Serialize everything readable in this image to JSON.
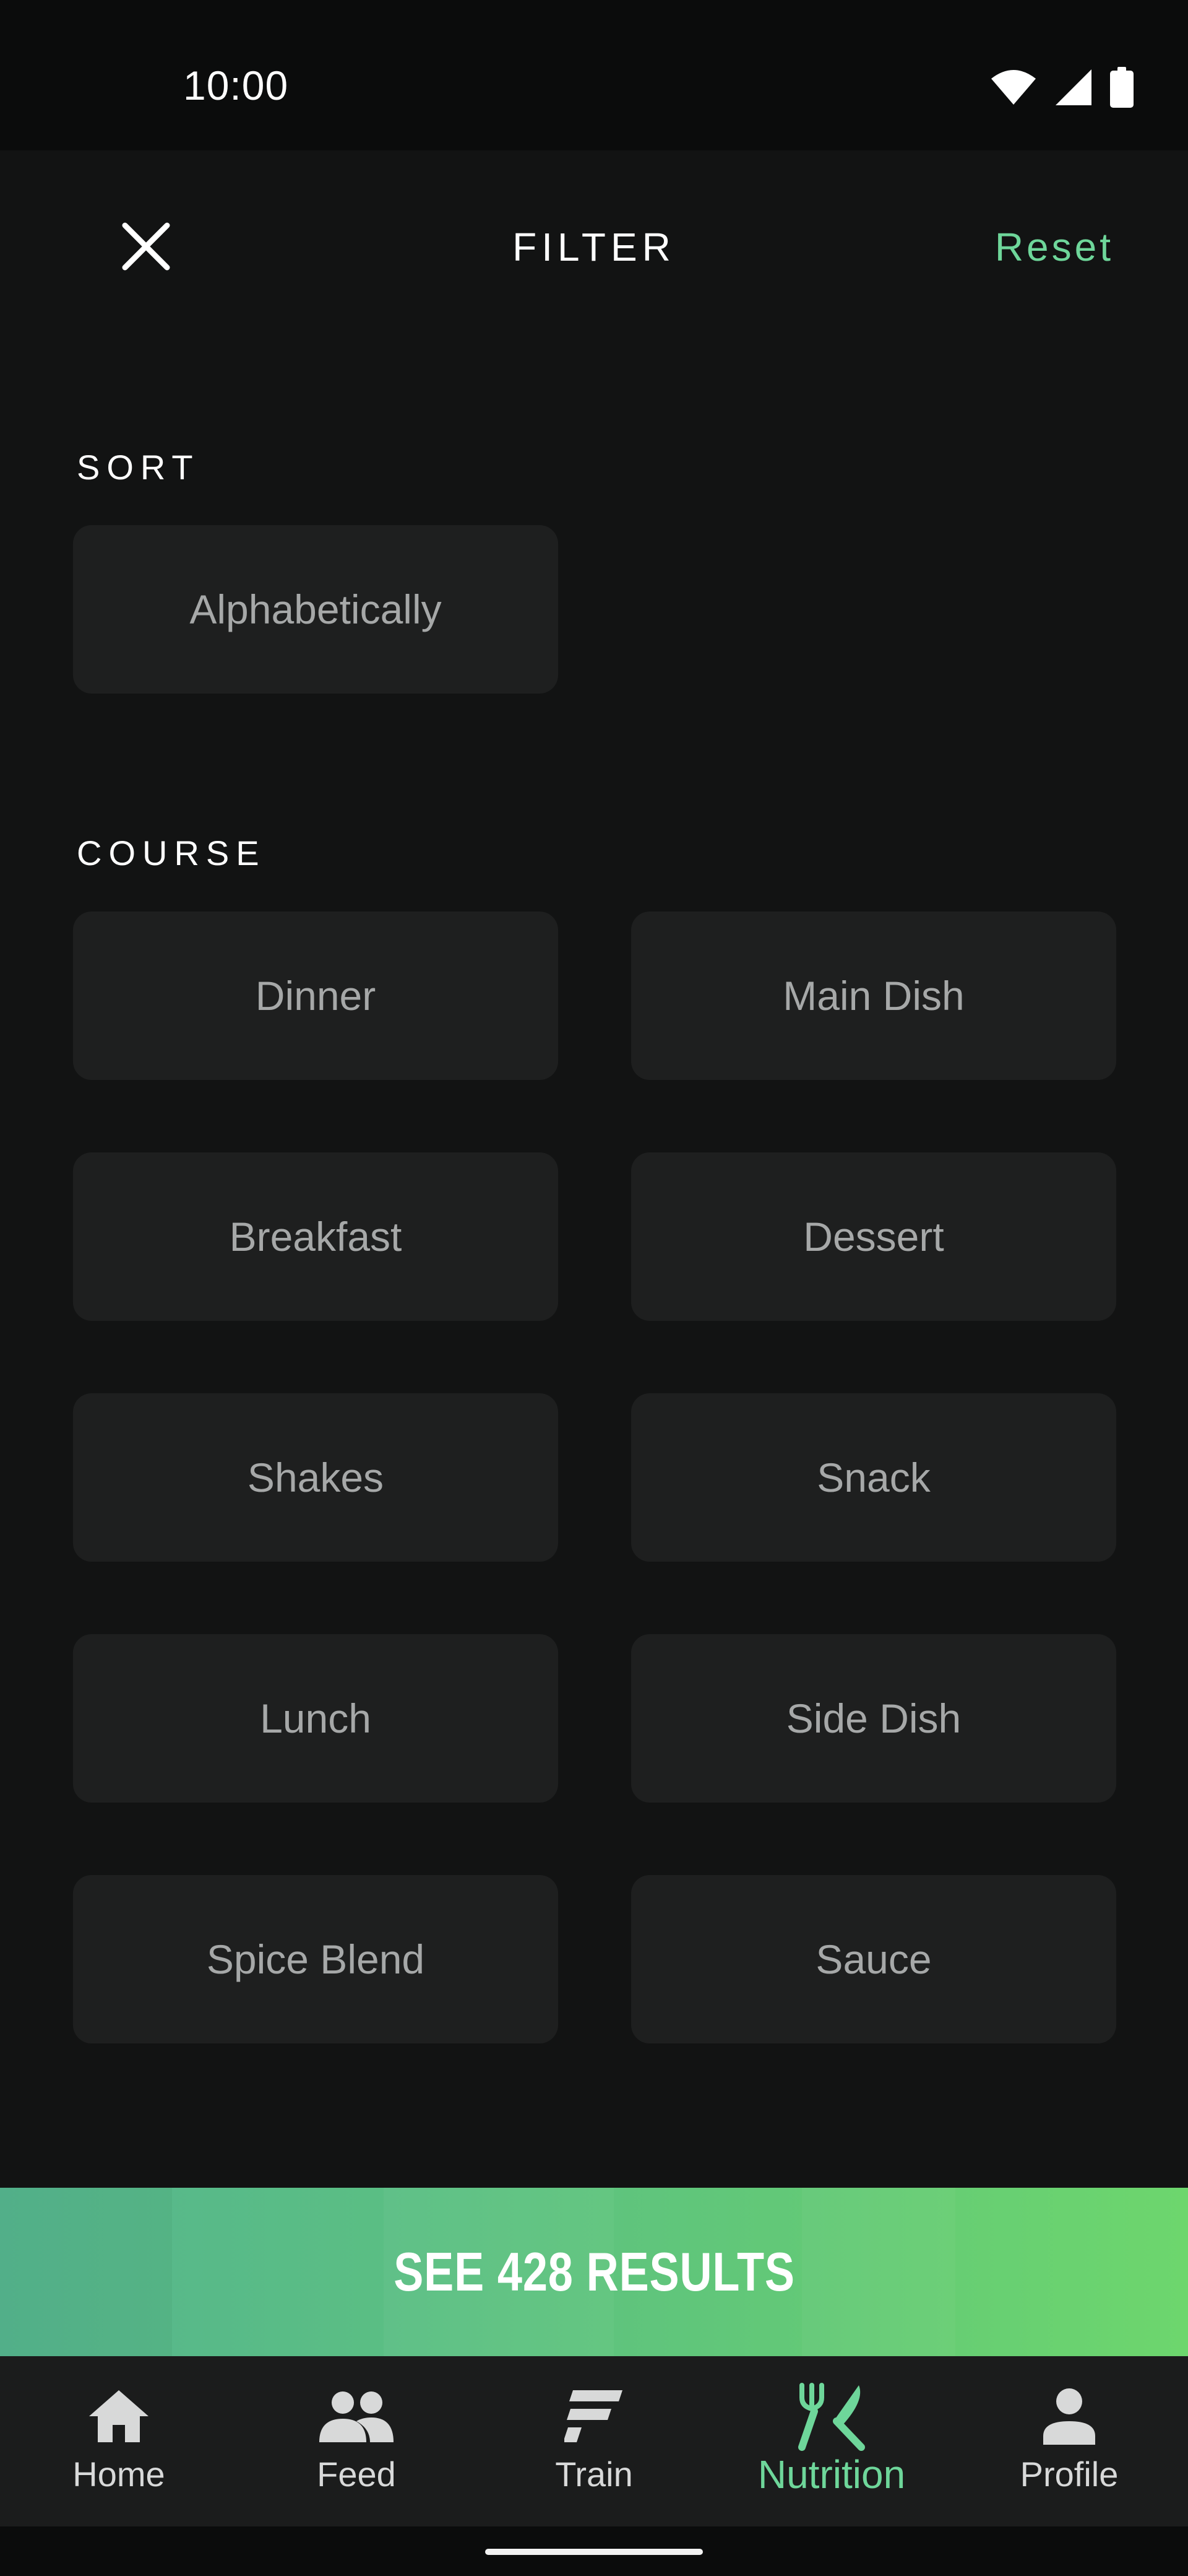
{
  "status_bar": {
    "time": "10:00",
    "icons": [
      "wifi-icon",
      "cellular-signal-icon",
      "battery-icon"
    ]
  },
  "header": {
    "close_icon": "close-icon",
    "title": "FILTER",
    "reset_label": "Reset"
  },
  "sort": {
    "title": "SORT",
    "options": [
      "Alphabetically"
    ]
  },
  "course": {
    "title": "COURSE",
    "options": [
      "Dinner",
      "Main Dish",
      "Breakfast",
      "Dessert",
      "Shakes",
      "Snack",
      "Lunch",
      "Side Dish",
      "Spice Blend",
      "Sauce"
    ]
  },
  "results_button": {
    "label": "SEE 428 RESULTS"
  },
  "bottom_nav": {
    "items": [
      {
        "label": "Home",
        "icon": "home-icon"
      },
      {
        "label": "Feed",
        "icon": "people-icon"
      },
      {
        "label": "Train",
        "icon": "train-icon"
      },
      {
        "label": "Nutrition",
        "icon": "fork-knife-icon",
        "active": true
      },
      {
        "label": "Profile",
        "icon": "person-icon"
      }
    ]
  },
  "colors": {
    "accent": "#6ed69a",
    "background": "#121313",
    "chip": "#1e1f1f",
    "chip_text": "#a6a8a8",
    "button_gradient_start": "#55b58e",
    "button_gradient_end": "#6dd66d"
  }
}
